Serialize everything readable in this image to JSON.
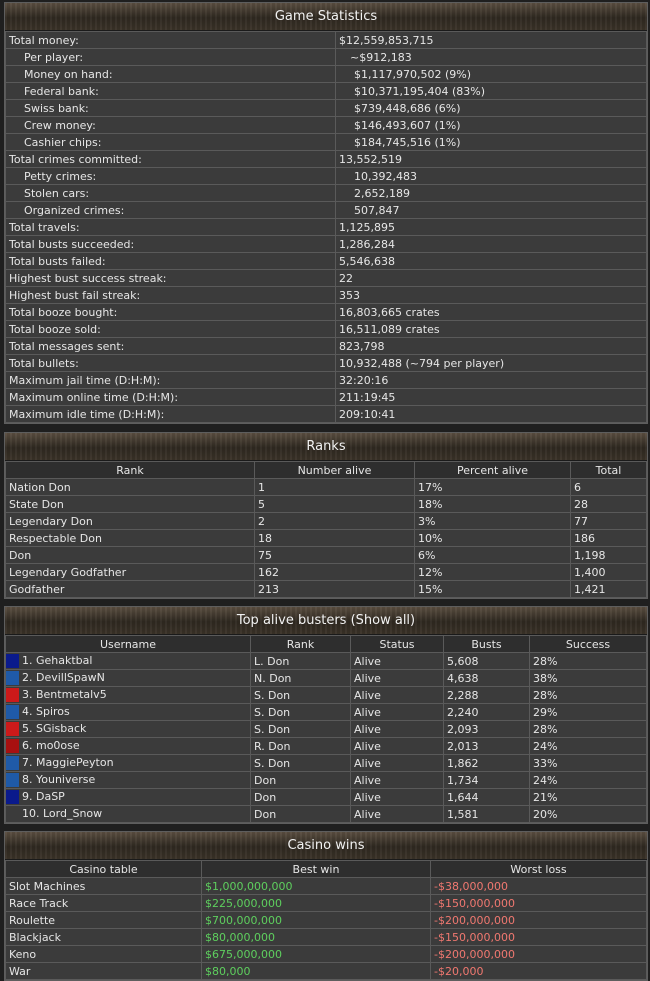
{
  "stats": {
    "title": "Game Statistics",
    "rows": [
      {
        "label": "Total money:",
        "value": "$12,559,853,715",
        "indent": 0
      },
      {
        "label": "Per player:",
        "value": "~$912,183",
        "indent": 1
      },
      {
        "label": "Money on hand:",
        "value": "$1,117,970,502 (9%)",
        "indent": 1
      },
      {
        "label": "Federal bank:",
        "value": "$10,371,195,404 (83%)",
        "indent": 1
      },
      {
        "label": "Swiss bank:",
        "value": "$739,448,686 (6%)",
        "indent": 1
      },
      {
        "label": "Crew money:",
        "value": "$146,493,607 (1%)",
        "indent": 1
      },
      {
        "label": "Cashier chips:",
        "value": "$184,745,516 (1%)",
        "indent": 1
      },
      {
        "label": "Total crimes committed:",
        "value": "13,552,519",
        "indent": 0
      },
      {
        "label": "Petty crimes:",
        "value": "10,392,483",
        "indent": 1
      },
      {
        "label": "Stolen cars:",
        "value": "2,652,189",
        "indent": 1
      },
      {
        "label": "Organized crimes:",
        "value": "507,847",
        "indent": 1
      },
      {
        "label": "Total travels:",
        "value": "1,125,895",
        "indent": 0
      },
      {
        "label": "Total busts succeeded:",
        "value": "1,286,284",
        "indent": 0
      },
      {
        "label": "Total busts failed:",
        "value": "5,546,638",
        "indent": 0
      },
      {
        "label": "Highest bust success streak:",
        "value": "22",
        "indent": 0
      },
      {
        "label": "Highest bust fail streak:",
        "value": "353",
        "indent": 0
      },
      {
        "label": "Total booze bought:",
        "value": "16,803,665 crates",
        "indent": 0
      },
      {
        "label": "Total booze sold:",
        "value": "16,511,089 crates",
        "indent": 0
      },
      {
        "label": "Total messages sent:",
        "value": "823,798",
        "indent": 0
      },
      {
        "label": "Total bullets:",
        "value": "10,932,488 (~794 per player)",
        "indent": 0
      },
      {
        "label": "Maximum jail time (D:H:M):",
        "value": "32:20:16",
        "indent": 0
      },
      {
        "label": "Maximum online time (D:H:M):",
        "value": "211:19:45",
        "indent": 0
      },
      {
        "label": "Maximum idle time (D:H:M):",
        "value": "209:10:41",
        "indent": 0
      }
    ]
  },
  "ranks": {
    "title": "Ranks",
    "headers": [
      "Rank",
      "Number alive",
      "Percent alive",
      "Total"
    ],
    "rows": [
      [
        "Nation Don",
        "1",
        "17%",
        "6"
      ],
      [
        "State Don",
        "5",
        "18%",
        "28"
      ],
      [
        "Legendary Don",
        "2",
        "3%",
        "77"
      ],
      [
        "Respectable Don",
        "18",
        "10%",
        "186"
      ],
      [
        "Don",
        "75",
        "6%",
        "1,198"
      ],
      [
        "Legendary Godfather",
        "162",
        "12%",
        "1,400"
      ],
      [
        "Godfather",
        "213",
        "15%",
        "1,421"
      ]
    ]
  },
  "busters": {
    "title": "Top alive busters (Show all)",
    "headers": [
      "Username",
      "Rank",
      "Status",
      "Busts",
      "Success"
    ],
    "rows": [
      {
        "color": "#0a1a8c",
        "name": "1. Gehaktbal",
        "rank": "L. Don",
        "status": "Alive",
        "busts": "5,608",
        "success": "28%"
      },
      {
        "color": "#1f5aa8",
        "name": "2. DevillSpawN",
        "rank": "N. Don",
        "status": "Alive",
        "busts": "4,638",
        "success": "38%"
      },
      {
        "color": "#cc1a1a",
        "name": "3. Bentmetalv5",
        "rank": "S. Don",
        "status": "Alive",
        "busts": "2,288",
        "success": "28%"
      },
      {
        "color": "#1f5aa8",
        "name": "4. Spiros",
        "rank": "S. Don",
        "status": "Alive",
        "busts": "2,240",
        "success": "29%"
      },
      {
        "color": "#cc1a1a",
        "name": "5. SGisback",
        "rank": "S. Don",
        "status": "Alive",
        "busts": "2,093",
        "success": "28%"
      },
      {
        "color": "#a81010",
        "name": "6. mo0ose",
        "rank": "R. Don",
        "status": "Alive",
        "busts": "2,013",
        "success": "24%"
      },
      {
        "color": "#1f5aa8",
        "name": "7. MaggiePeyton",
        "rank": "S. Don",
        "status": "Alive",
        "busts": "1,862",
        "success": "33%"
      },
      {
        "color": "#1f5aa8",
        "name": "8. Youniverse",
        "rank": "Don",
        "status": "Alive",
        "busts": "1,734",
        "success": "24%"
      },
      {
        "color": "#0a1a8c",
        "name": "9. DaSP",
        "rank": "Don",
        "status": "Alive",
        "busts": "1,644",
        "success": "21%"
      },
      {
        "color": "",
        "name": "10. Lord_Snow",
        "rank": "Don",
        "status": "Alive",
        "busts": "1,581",
        "success": "20%"
      }
    ]
  },
  "casino": {
    "title": "Casino wins",
    "headers": [
      "Casino table",
      "Best win",
      "Worst loss"
    ],
    "rows": [
      [
        "Slot Machines",
        "$1,000,000,000",
        "-$38,000,000"
      ],
      [
        "Race Track",
        "$225,000,000",
        "-$150,000,000"
      ],
      [
        "Roulette",
        "$700,000,000",
        "-$200,000,000"
      ],
      [
        "Blackjack",
        "$80,000,000",
        "-$150,000,000"
      ],
      [
        "Keno",
        "$675,000,000",
        "-$200,000,000"
      ],
      [
        "War",
        "$80,000",
        "-$20,000"
      ]
    ]
  }
}
